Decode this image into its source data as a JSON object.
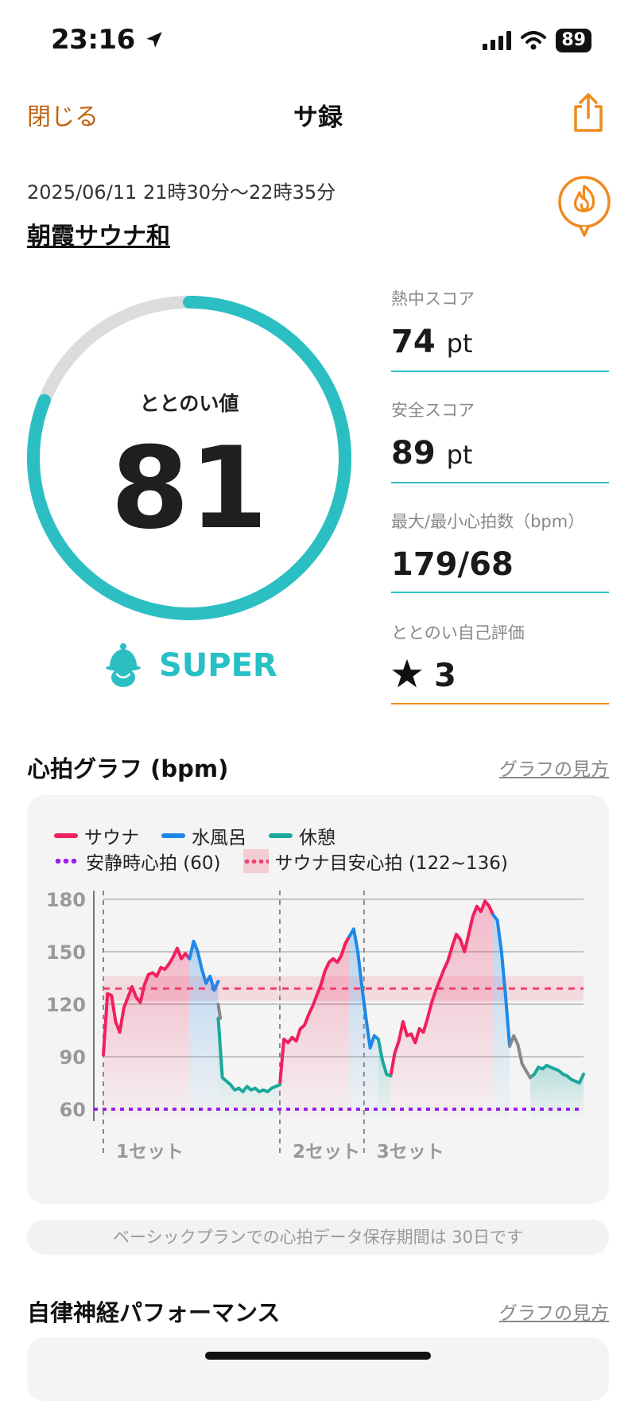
{
  "status_bar": {
    "time": "23:16",
    "battery": "89"
  },
  "nav": {
    "close_label": "閉じる",
    "title": "サ録"
  },
  "session": {
    "datetime": "2025/06/11 21時30分〜22時35分",
    "place": "朝霞サウナ和"
  },
  "gauge": {
    "label": "ととのい値",
    "value": "81",
    "fraction": 0.81,
    "rank": "SUPER"
  },
  "scores": [
    {
      "label": "熱中スコア",
      "value": "74",
      "unit": "pt"
    },
    {
      "label": "安全スコア",
      "value": "89",
      "unit": "pt"
    },
    {
      "label": "最大/最小心拍数（bpm）",
      "value": "179/68",
      "unit": ""
    },
    {
      "label": "ととのい自己評価",
      "value": "3",
      "unit": "",
      "icon": "star-icon"
    }
  ],
  "heart_section": {
    "title": "心拍グラフ (bpm)",
    "howto": "グラフの見方"
  },
  "legend": {
    "sauna": "サウナ",
    "water": "水風呂",
    "rest": "休憩",
    "resting_hr": "安静時心拍 (60)",
    "target_hr": "サウナ目安心拍 (122~136)"
  },
  "colors": {
    "accent_orange": "#f08a1f",
    "teal": "#2bbfc4",
    "sauna": "#f0205e",
    "water": "#1e88e8",
    "rest": "#1aa89c",
    "resting_line": "#9b1ee8",
    "target_band": "#f0406e"
  },
  "chart_data": {
    "type": "line",
    "ylabel": "",
    "ylim": [
      55,
      185
    ],
    "yticks": [
      60,
      90,
      120,
      150,
      180
    ],
    "resting_hr": 60,
    "target_range": [
      122,
      136
    ],
    "sets": [
      "1セット",
      "2セット",
      "3セット"
    ],
    "x_unit_note": "",
    "series": [
      {
        "name": "サウナ",
        "color": "#f0205e",
        "segments": [
          [
            [
              0,
              91
            ],
            [
              1,
              126
            ],
            [
              2,
              125
            ],
            [
              3,
              110
            ],
            [
              4,
              104
            ],
            [
              5,
              118
            ],
            [
              6,
              124
            ],
            [
              7,
              130
            ],
            [
              8,
              124
            ],
            [
              9,
              121
            ],
            [
              10,
              131
            ],
            [
              11,
              137
            ],
            [
              12,
              138
            ],
            [
              13,
              136
            ],
            [
              14,
              141
            ],
            [
              15,
              140
            ],
            [
              16,
              143
            ],
            [
              17,
              147
            ],
            [
              18,
              152
            ],
            [
              19,
              146
            ],
            [
              20,
              149
            ],
            [
              21,
              146
            ]
          ],
          [
            [
              43,
              74
            ],
            [
              44,
              100
            ],
            [
              45,
              98
            ],
            [
              46,
              101
            ],
            [
              47,
              99
            ],
            [
              48,
              106
            ],
            [
              49,
              108
            ],
            [
              50,
              114
            ],
            [
              51,
              119
            ],
            [
              52,
              125
            ],
            [
              53,
              131
            ],
            [
              54,
              139
            ],
            [
              55,
              144
            ],
            [
              56,
              146
            ],
            [
              57,
              144
            ],
            [
              58,
              148
            ],
            [
              59,
              155
            ],
            [
              60,
              159
            ]
          ],
          [
            [
              70,
              79
            ],
            [
              71,
              92
            ],
            [
              72,
              99
            ],
            [
              73,
              110
            ],
            [
              74,
              102
            ],
            [
              75,
              103
            ],
            [
              76,
              98
            ],
            [
              77,
              106
            ],
            [
              78,
              104
            ],
            [
              79,
              112
            ],
            [
              80,
              121
            ],
            [
              81,
              128
            ],
            [
              82,
              134
            ],
            [
              83,
              140
            ],
            [
              84,
              145
            ],
            [
              85,
              153
            ],
            [
              86,
              160
            ],
            [
              87,
              157
            ],
            [
              88,
              150
            ],
            [
              89,
              160
            ],
            [
              90,
              170
            ],
            [
              91,
              176
            ],
            [
              92,
              173
            ],
            [
              93,
              179
            ],
            [
              94,
              176
            ],
            [
              95,
              171
            ]
          ]
        ]
      },
      {
        "name": "水風呂",
        "color": "#1e88e8",
        "segments": [
          [
            [
              21,
              146
            ],
            [
              22,
              156
            ],
            [
              23,
              150
            ],
            [
              24,
              140
            ],
            [
              25,
              132
            ],
            [
              26,
              136
            ],
            [
              27,
              128
            ],
            [
              28,
              133
            ]
          ],
          [
            [
              60,
              159
            ],
            [
              61,
              163
            ],
            [
              62,
              150
            ],
            [
              63,
              130
            ],
            [
              64,
              112
            ],
            [
              65,
              95
            ],
            [
              66,
              102
            ],
            [
              67,
              100
            ]
          ],
          [
            [
              95,
              171
            ],
            [
              96,
              168
            ],
            [
              97,
              150
            ],
            [
              98,
              125
            ],
            [
              99,
              96
            ]
          ]
        ]
      },
      {
        "name": "休憩",
        "color": "#1aa89c",
        "segments": [
          [
            [
              28,
              112
            ],
            [
              29,
              78
            ],
            [
              30,
              76
            ],
            [
              31,
              74
            ],
            [
              32,
              71
            ],
            [
              33,
              72
            ],
            [
              34,
              70
            ],
            [
              35,
              73
            ],
            [
              36,
              71
            ],
            [
              37,
              72
            ],
            [
              38,
              70
            ],
            [
              39,
              71
            ],
            [
              40,
              70
            ],
            [
              41,
              72
            ],
            [
              42,
              73
            ],
            [
              43,
              74
            ]
          ],
          [
            [
              67,
              100
            ],
            [
              68,
              88
            ],
            [
              69,
              80
            ],
            [
              70,
              79
            ]
          ],
          [
            [
              104,
              78
            ],
            [
              105,
              80
            ],
            [
              106,
              84
            ],
            [
              107,
              83
            ],
            [
              108,
              85
            ],
            [
              109,
              84
            ],
            [
              110,
              83
            ],
            [
              111,
              82
            ],
            [
              112,
              80
            ],
            [
              113,
              79
            ],
            [
              114,
              77
            ],
            [
              115,
              76
            ],
            [
              116,
              75
            ],
            [
              117,
              80
            ]
          ]
        ]
      },
      {
        "name": "",
        "color": "#888888",
        "segments": [
          [
            [
              28,
              120
            ],
            [
              28.5,
              112
            ]
          ],
          [
            [
              99,
              96
            ],
            [
              100,
              102
            ],
            [
              101,
              97
            ],
            [
              102,
              86
            ],
            [
              103,
              82
            ],
            [
              104,
              78
            ]
          ]
        ]
      }
    ],
    "set_markers": [
      0,
      43,
      63.5
    ]
  },
  "notice": "ベーシックプランでの心拍データ保存期間は 30日です",
  "anp_section": {
    "title": "自律神経パフォーマンス",
    "howto": "グラフの見方"
  }
}
